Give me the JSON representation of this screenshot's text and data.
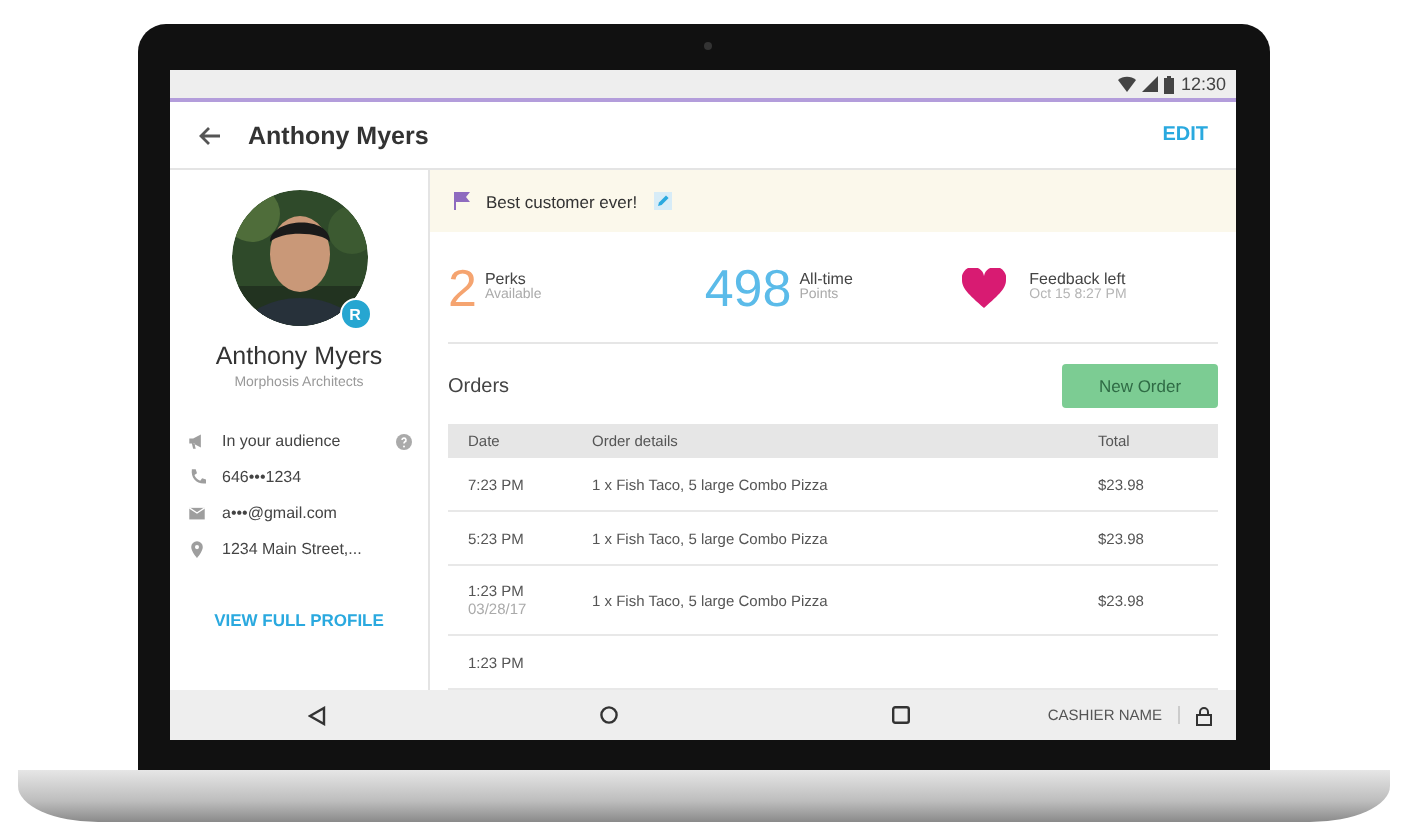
{
  "status_bar": {
    "time": "12:30"
  },
  "header": {
    "title": "Anthony Myers",
    "action": "EDIT"
  },
  "profile": {
    "name": "Anthony Myers",
    "company": "Morphosis Architects",
    "badge": "R",
    "details": [
      {
        "kind": "audience",
        "text": "In your audience"
      },
      {
        "kind": "phone",
        "text": "646•••1234"
      },
      {
        "kind": "email",
        "text": "a•••@gmail.com"
      },
      {
        "kind": "address",
        "text": "1234 Main Street,..."
      }
    ],
    "link": "VIEW FULL PROFILE"
  },
  "note": {
    "text": "Best customer ever!"
  },
  "stats": [
    {
      "kind": "number",
      "value": "2",
      "label": "Perks",
      "sub": "Available",
      "color": "#f5a470"
    },
    {
      "kind": "number",
      "value": "498",
      "label": "All-time",
      "sub": "Points",
      "color": "#5bbbe9"
    },
    {
      "kind": "heart",
      "label": "Feedback left",
      "sub": "Oct 15 8:27 PM",
      "color": "#d81b72"
    }
  ],
  "orders": {
    "title": "Orders",
    "button": "New Order",
    "columns": [
      "Date",
      "Order details",
      "Total"
    ],
    "rows": [
      {
        "time": "7:23 PM",
        "details": "1 x Fish Taco, 5 large Combo Pizza",
        "total": "$23.98"
      },
      {
        "time": "5:23 PM",
        "details": "1 x Fish Taco, 5 large Combo Pizza",
        "total": "$23.98"
      },
      {
        "time": "1:23 PM",
        "date": "03/28/17",
        "details": "1 x Fish Taco, 5 large Combo Pizza",
        "total": "$23.98"
      },
      {
        "time": "1:23 PM"
      }
    ]
  },
  "nav_bar": {
    "cashier": "CASHIER NAME"
  }
}
